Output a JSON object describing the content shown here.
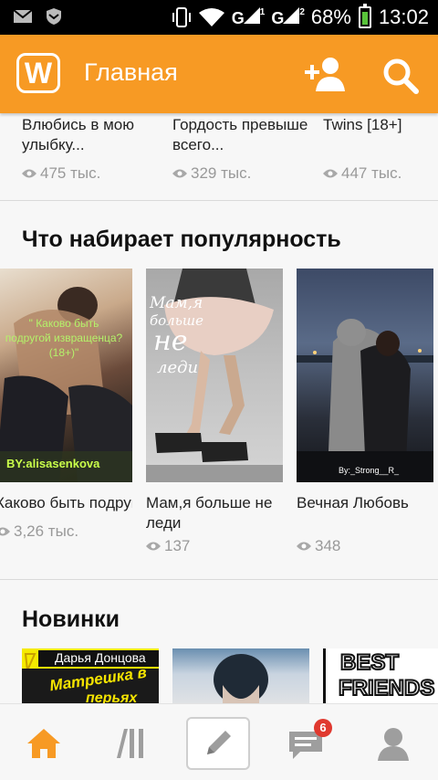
{
  "status_bar": {
    "battery": "68%",
    "time": "13:02",
    "sim1": "1",
    "sim2": "2",
    "signal_label": "G"
  },
  "app_bar": {
    "logo_letter": "W",
    "title": "Главная",
    "accent_color": "#f79a24"
  },
  "top_row": [
    {
      "title": "Влюбись в мою улыбку...",
      "views": "475 тыс."
    },
    {
      "title": "Гордость превыше всего...",
      "views": "329 тыс."
    },
    {
      "title": "Twins [18+]",
      "views": "447 тыс."
    }
  ],
  "popular": {
    "heading": "Что набирает популярность",
    "items": [
      {
        "title": "Каково  быть подругой...",
        "views": "3,26 тыс.",
        "cover_text": "\" Каково быть подругой извращенца? (18+)\"",
        "cover_author": "BY:alisasenkova"
      },
      {
        "title": "Мам,я больше не леди",
        "views": "137",
        "cover_text_1": "Мам,я",
        "cover_text_2": "больше",
        "cover_text_3": "не",
        "cover_text_4": "леди"
      },
      {
        "title": "Вечная Любовь",
        "views": "348",
        "cover_author": "By:_Strong__R_"
      }
    ]
  },
  "new_section": {
    "heading": "Новинки",
    "items": [
      {
        "author": "Дарья Донцова",
        "title_a": "Матрешка в",
        "title_b": "перьях"
      },
      {},
      {
        "title_a": "BEST",
        "title_b": "FRIENDS"
      }
    ]
  },
  "bottom_nav": {
    "messages_badge": "6",
    "active_color": "#f79a24",
    "inactive_color": "#9e9e9e"
  }
}
